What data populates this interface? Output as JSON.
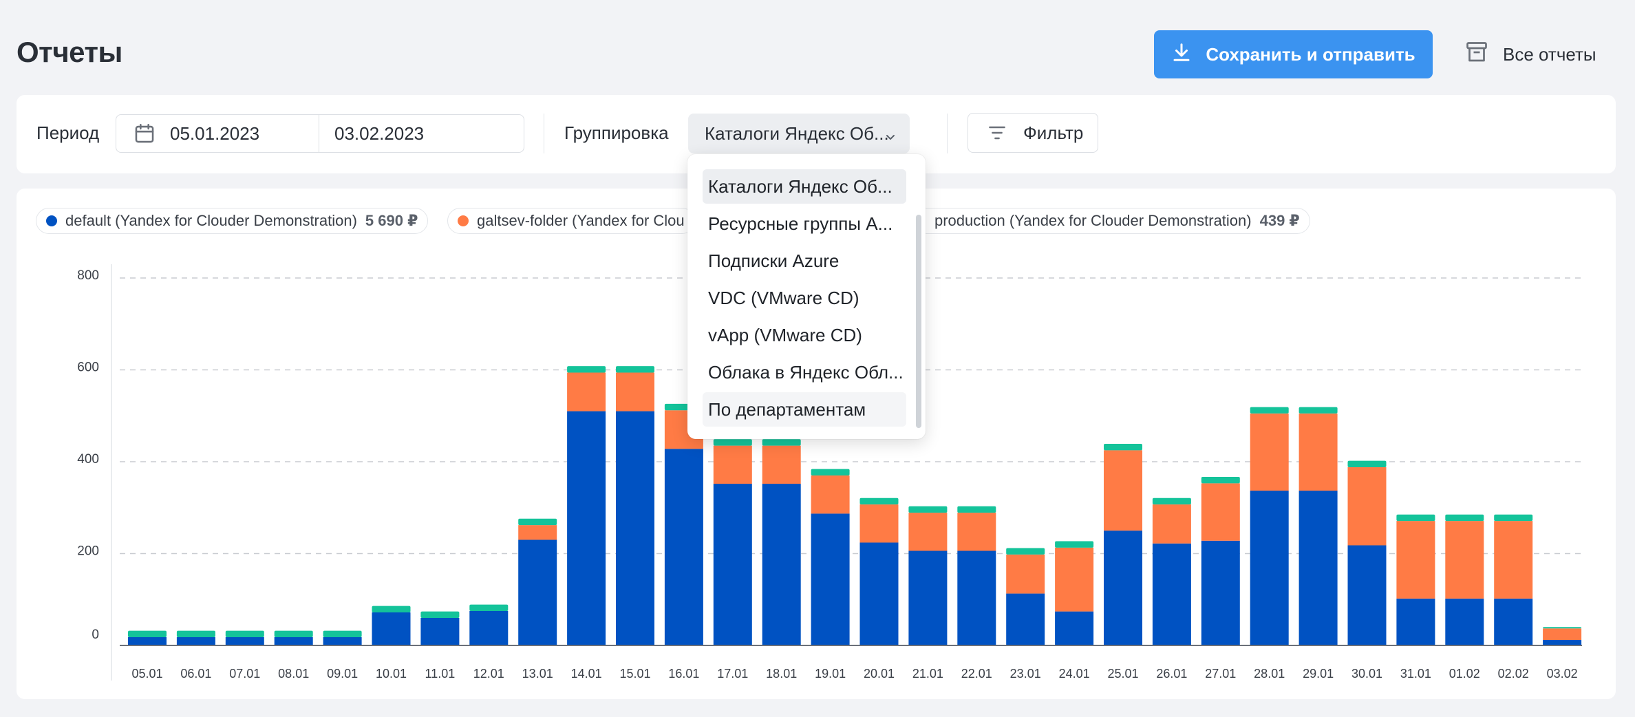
{
  "header": {
    "title": "Отчеты",
    "save_button": "Сохранить и отправить",
    "all_reports": "Все отчеты"
  },
  "filters": {
    "period_label": "Период",
    "date_from": "05.01.2023",
    "date_to": "03.02.2023",
    "grouping_label": "Группировка",
    "grouping_value": "Каталоги Яндекс Об...",
    "filter_button": "Фильтр"
  },
  "dropdown": {
    "options": [
      "Каталоги Яндекс Об...",
      "Ресурсные группы A...",
      "Подписки Azure",
      "VDC (VMware CD)",
      "vApp (VMware CD)",
      "Облака в Яндекс Обл...",
      "По департаментам"
    ],
    "selected_index": 0,
    "hover_index": 6
  },
  "legend": [
    {
      "label": "default (Yandex for Clouder Demonstration)",
      "amount": "5 690 ₽",
      "color": "#0052c2"
    },
    {
      "label": "galtsev-folder (Yandex for Clou",
      "amount": "",
      "color": "#ff7b45"
    },
    {
      "label": "production (Yandex for Clouder Demonstration)",
      "amount": "439 ₽",
      "color": "#14c39a"
    }
  ],
  "chart_data": {
    "type": "bar",
    "stacked": true,
    "categories": [
      "05.01",
      "06.01",
      "07.01",
      "08.01",
      "09.01",
      "10.01",
      "11.01",
      "12.01",
      "13.01",
      "14.01",
      "15.01",
      "16.01",
      "17.01",
      "18.01",
      "19.01",
      "20.01",
      "21.01",
      "22.01",
      "23.01",
      "24.01",
      "25.01",
      "26.01",
      "27.01",
      "28.01",
      "29.01",
      "30.01",
      "31.01",
      "01.02",
      "02.02",
      "03.02"
    ],
    "series": [
      {
        "name": "default (Yandex for Clouder Demonstration)",
        "color": "#0052c2",
        "values": [
          18,
          18,
          18,
          18,
          18,
          72,
          60,
          75,
          230,
          510,
          510,
          428,
          352,
          352,
          287,
          224,
          206,
          206,
          113,
          74,
          250,
          222,
          228,
          337,
          337,
          218,
          102,
          102,
          102,
          12
        ]
      },
      {
        "name": "galtsev-folder (Yandex for Clou",
        "color": "#ff7b45",
        "values": [
          0,
          0,
          0,
          0,
          0,
          0,
          0,
          0,
          32,
          84,
          84,
          84,
          83,
          83,
          83,
          83,
          83,
          83,
          85,
          139,
          175,
          85,
          125,
          168,
          168,
          170,
          169,
          169,
          169,
          25
        ]
      },
      {
        "name": "production (Yandex for Clouder Demonstration)",
        "color": "#14c39a",
        "values": [
          14,
          14,
          14,
          14,
          14,
          14,
          14,
          14,
          14,
          14,
          14,
          14,
          14,
          14,
          14,
          14,
          14,
          14,
          14,
          14,
          14,
          14,
          14,
          14,
          14,
          14,
          14,
          14,
          14,
          3
        ]
      }
    ],
    "y_ticks": [
      0,
      200,
      400,
      600,
      800
    ],
    "ylim": [
      0,
      800
    ],
    "grid": true
  }
}
